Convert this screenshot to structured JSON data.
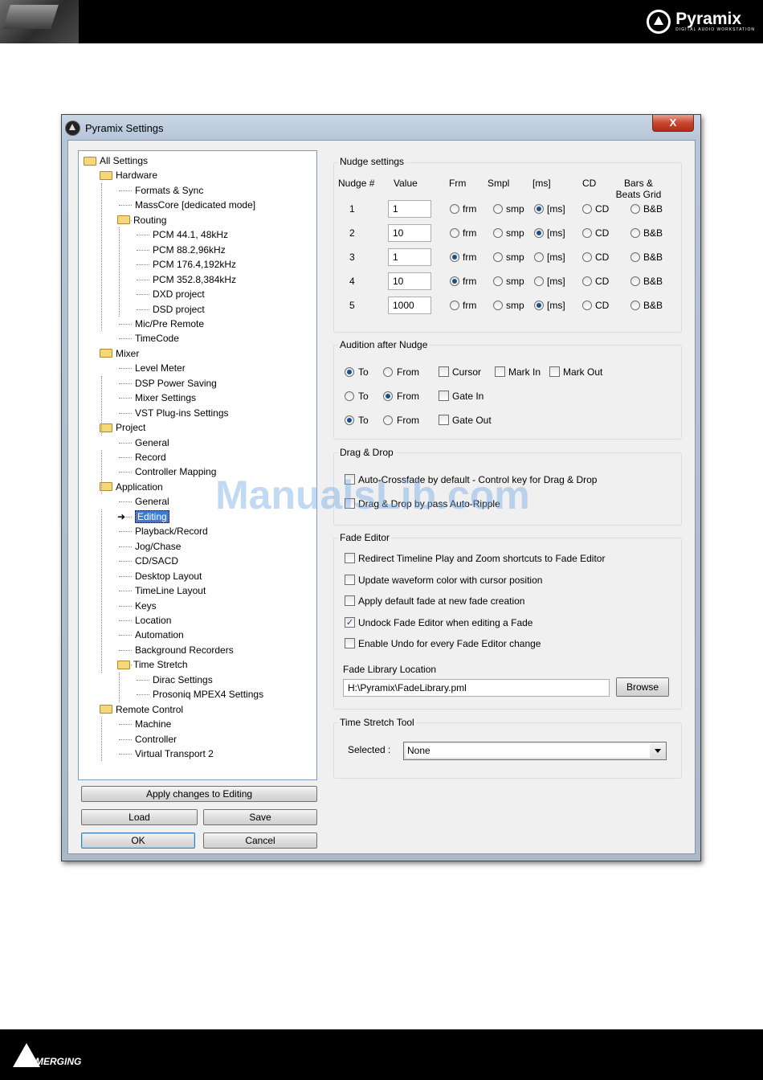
{
  "header": {
    "brand": "Pyramix",
    "brand_sub": "DIGITAL AUDIO WORKSTATION"
  },
  "footer": {
    "brand": "MERGING"
  },
  "watermark": "ManualsLib.com",
  "window": {
    "title": "Pyramix Settings",
    "close": "X"
  },
  "tree": {
    "root": "All Settings",
    "hardware": {
      "label": "Hardware",
      "children": [
        "Formats & Sync",
        "MassCore [dedicated mode]"
      ],
      "routing": {
        "label": "Routing",
        "children": [
          "PCM 44.1, 48kHz",
          "PCM 88.2,96kHz",
          "PCM 176.4,192kHz",
          "PCM 352.8,384kHz",
          "DXD project",
          "DSD project"
        ]
      },
      "after": [
        "Mic/Pre Remote",
        "TimeCode"
      ]
    },
    "mixer": {
      "label": "Mixer",
      "children": [
        "Level Meter",
        "DSP Power Saving",
        "Mixer Settings",
        "VST Plug-ins Settings"
      ]
    },
    "project": {
      "label": "Project",
      "children": [
        "General",
        "Record",
        "Controller Mapping"
      ]
    },
    "application": {
      "label": "Application",
      "children": [
        "General",
        "Editing",
        "Playback/Record",
        "Jog/Chase",
        "CD/SACD",
        "Desktop Layout",
        "TimeLine Layout",
        "Keys",
        "Location",
        "Automation",
        "Background Recorders"
      ],
      "timestretch": {
        "label": "Time Stretch",
        "children": [
          "Dirac Settings",
          "Prosoniq MPEX4 Settings"
        ]
      }
    },
    "remote": {
      "label": "Remote Control",
      "children": [
        "Machine",
        "Controller",
        "Virtual Transport 2"
      ]
    }
  },
  "buttons": {
    "apply": "Apply changes to Editing",
    "load": "Load",
    "save": "Save",
    "ok": "OK",
    "cancel": "Cancel",
    "browse": "Browse"
  },
  "nudge": {
    "title": "Nudge settings",
    "headers": {
      "nudge": "Nudge #",
      "value": "Value",
      "frm": "Frm",
      "smpl": "Smpl",
      "ms": "[ms]",
      "cd": "CD",
      "bars": "Bars &",
      "beats": "Beats Grid"
    },
    "opt": {
      "frm": "frm",
      "smp": "smp",
      "ms": "[ms]",
      "cd": "CD",
      "bb": "B&B"
    },
    "rows": [
      {
        "n": "1",
        "value": "1",
        "sel": "ms"
      },
      {
        "n": "2",
        "value": "10",
        "sel": "ms"
      },
      {
        "n": "3",
        "value": "1",
        "sel": "frm"
      },
      {
        "n": "4",
        "value": "10",
        "sel": "frm"
      },
      {
        "n": "5",
        "value": "1000",
        "sel": "ms"
      }
    ]
  },
  "audition": {
    "title": "Audition after Nudge",
    "to": "To",
    "from": "From",
    "rows": [
      {
        "sel": "to",
        "checks": [
          "Cursor",
          "Mark In",
          "Mark Out"
        ]
      },
      {
        "sel": "from",
        "checks": [
          "Gate In"
        ]
      },
      {
        "sel": "to",
        "checks": [
          "Gate Out"
        ]
      }
    ]
  },
  "dragdrop": {
    "title": "Drag & Drop",
    "items": [
      {
        "label": "Auto-Crossfade by default - Control key for Drag & Drop",
        "checked": false
      },
      {
        "label": "Drag & Drop by pass Auto-Ripple",
        "checked": false
      }
    ]
  },
  "fade": {
    "title": "Fade Editor",
    "items": [
      {
        "label": "Redirect Timeline Play and Zoom shortcuts to Fade Editor",
        "checked": false
      },
      {
        "label": "Update waveform color with cursor position",
        "checked": false
      },
      {
        "label": "Apply default fade at new fade creation",
        "checked": false
      },
      {
        "label": "Undock Fade Editor when editing a Fade",
        "checked": true
      },
      {
        "label": "Enable Undo for every Fade Editor change",
        "checked": false
      }
    ],
    "location_label": "Fade Library Location",
    "location_value": "H:\\Pyramix\\FadeLibrary.pml"
  },
  "timestretch": {
    "title": "Time Stretch Tool",
    "selected_label": "Selected :",
    "selected_value": "None"
  }
}
